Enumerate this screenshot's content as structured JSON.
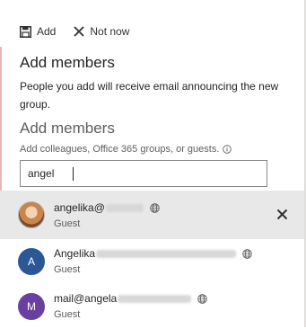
{
  "command_bar": {
    "add_label": "Add",
    "not_now_label": "Not now"
  },
  "panel": {
    "title": "Add members",
    "description": "People you add will receive email announcing the new group.",
    "section_title": "Add members",
    "hint": "Add colleagues, Office 365 groups, or guests."
  },
  "search": {
    "value": "angel"
  },
  "suggestions": [
    {
      "name": "angelika@",
      "type": "Guest",
      "avatar": "photo",
      "initial": ""
    },
    {
      "name": "Angelika",
      "type": "Guest",
      "avatar": "initial",
      "initial": "A",
      "color": "#2b5797"
    },
    {
      "name": "mail@angela",
      "type": "Guest",
      "avatar": "initial",
      "initial": "M",
      "color": "#6b3fa0"
    }
  ],
  "icons": {
    "add": "save-icon",
    "not_now": "close-icon",
    "hint": "info-icon",
    "external": "globe-icon",
    "remove": "close-icon"
  }
}
